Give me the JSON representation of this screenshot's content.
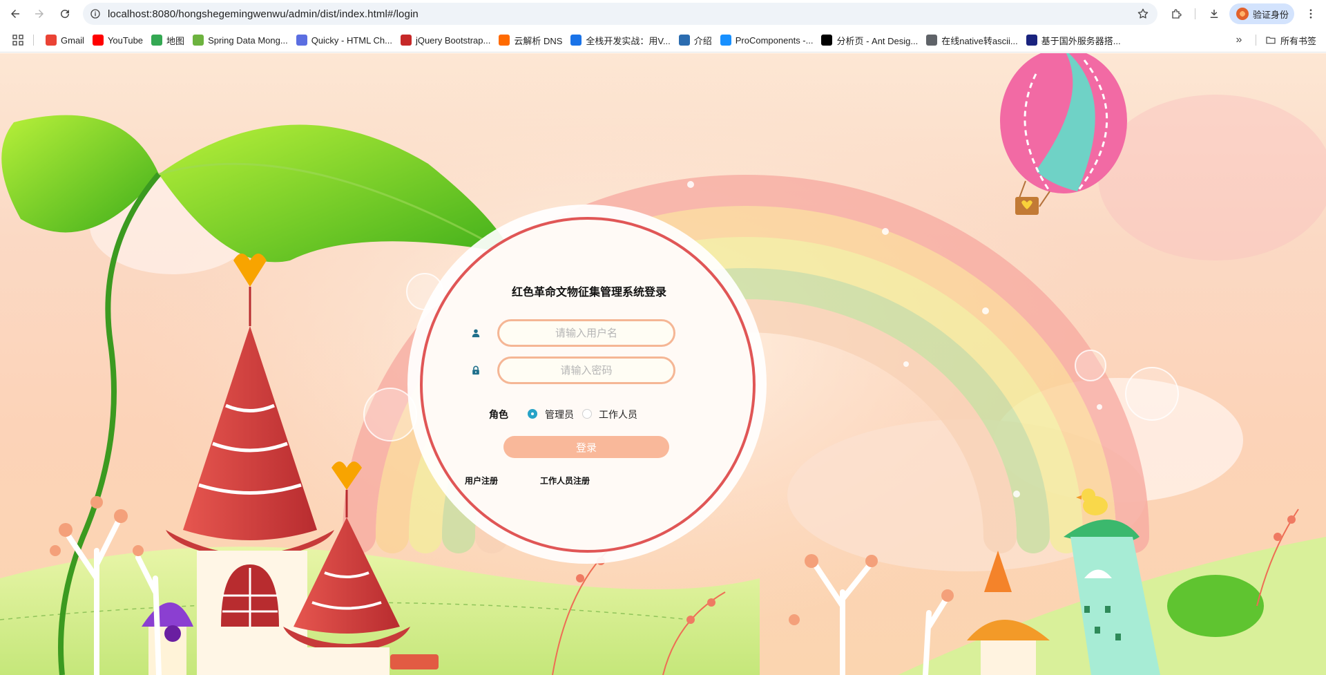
{
  "browser": {
    "url": "localhost:8080/hongshegemingwenwu/admin/dist/index.html#/login",
    "profile_label": "验证身份",
    "bookmarks": [
      {
        "label": "Gmail",
        "icon": "gmail-icon",
        "color": "#ea4335"
      },
      {
        "label": "YouTube",
        "icon": "youtube-icon",
        "color": "#ff0000"
      },
      {
        "label": "地图",
        "icon": "maps-icon",
        "color": "#34a853"
      },
      {
        "label": "Spring Data Mong...",
        "icon": "spring-icon",
        "color": "#6db33f"
      },
      {
        "label": "Quicky - HTML Ch...",
        "icon": "quicky-icon",
        "color": "#5b6ee1"
      },
      {
        "label": "jQuery Bootstrap...",
        "icon": "jquery-icon",
        "color": "#c62828"
      },
      {
        "label": "云解析 DNS",
        "icon": "aliyun-icon",
        "color": "#ff6a00"
      },
      {
        "label": "全栈开发实战：用V...",
        "icon": "m-icon",
        "color": "#1a73e8"
      },
      {
        "label": "介绍",
        "icon": "intro-icon",
        "color": "#2b6cb0"
      },
      {
        "label": "ProComponents -...",
        "icon": "procomponents-icon",
        "color": "#1890ff"
      },
      {
        "label": "分析页 - Ant Desig...",
        "icon": "pro-icon",
        "color": "#000000"
      },
      {
        "label": "在线native转ascii...",
        "icon": "globe-icon",
        "color": "#5f6368"
      },
      {
        "label": "基于国外服务器搭...",
        "icon": "server-icon",
        "color": "#1a237e"
      }
    ],
    "all_bookmarks": "所有书签"
  },
  "login": {
    "title": "红色革命文物征集管理系统登录",
    "username_placeholder": "请输入用户名",
    "password_placeholder": "请输入密码",
    "role_label": "角色",
    "roles": [
      {
        "label": "管理员",
        "checked": true
      },
      {
        "label": "工作人员",
        "checked": false
      }
    ],
    "login_button": "登录",
    "register_user": "用户注册",
    "register_staff": "工作人员注册"
  },
  "colors": {
    "accent": "#27a3c7",
    "card_border": "#e05656",
    "input_border": "#f5b695",
    "button_bg": "#f9b89a"
  }
}
